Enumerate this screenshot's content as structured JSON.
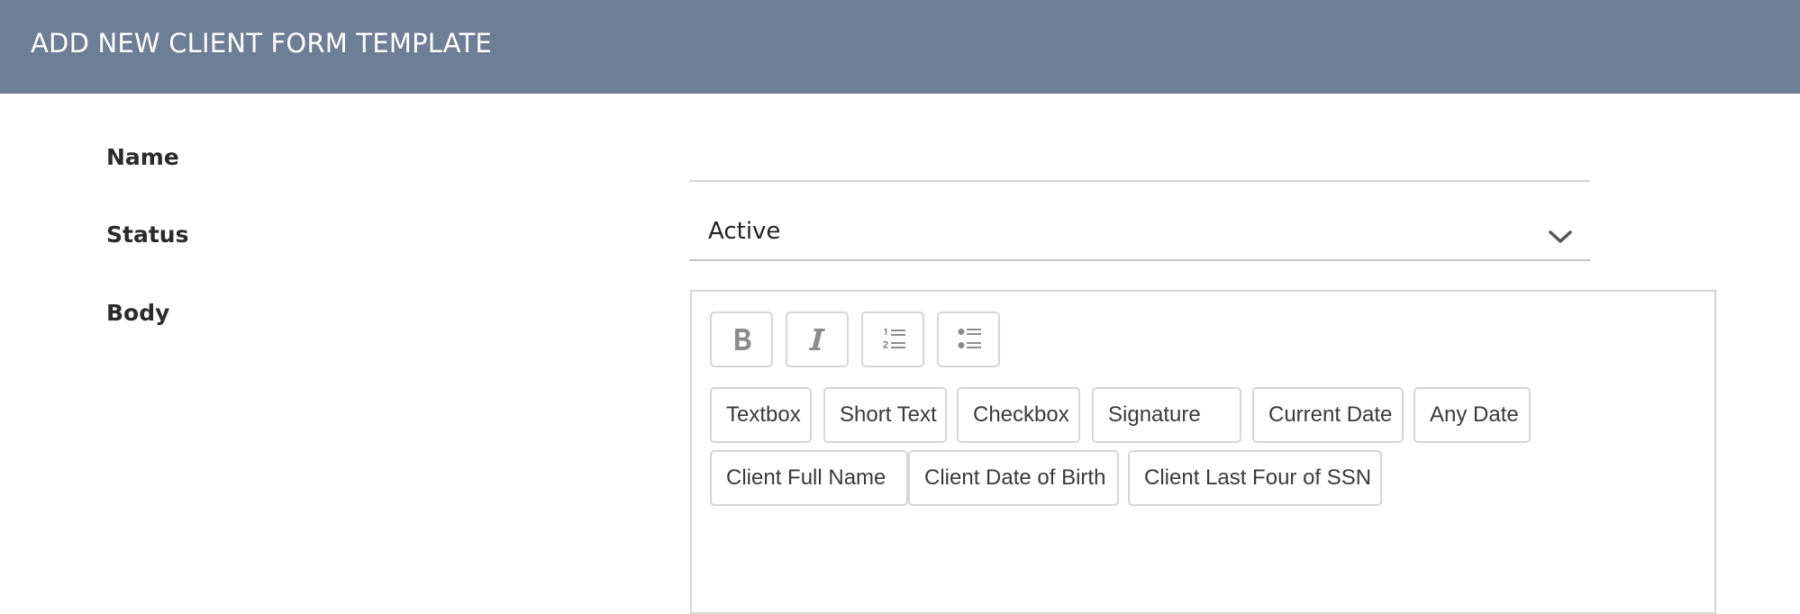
{
  "header": {
    "title": "ADD NEW CLIENT FORM TEMPLATE",
    "background_color": "#6e7e96"
  },
  "form": {
    "name_label": "Name",
    "name_value": "",
    "status_label": "Status",
    "status_value": "Active",
    "body_label": "Body"
  },
  "editor": {
    "format_buttons": [
      {
        "name": "bold",
        "icon": "bold-icon"
      },
      {
        "name": "italic",
        "icon": "italic-icon"
      },
      {
        "name": "ordered-list",
        "icon": "ordered-list-icon"
      },
      {
        "name": "unordered-list",
        "icon": "unordered-list-icon"
      }
    ],
    "chips_row1": [
      "Textbox",
      "Short Text",
      "Checkbox",
      "Signature",
      "Current Date",
      "Any Date"
    ],
    "chips_row2": [
      "Client Full Name",
      "Client Date of Birth",
      "Client Last Four of SSN"
    ]
  }
}
